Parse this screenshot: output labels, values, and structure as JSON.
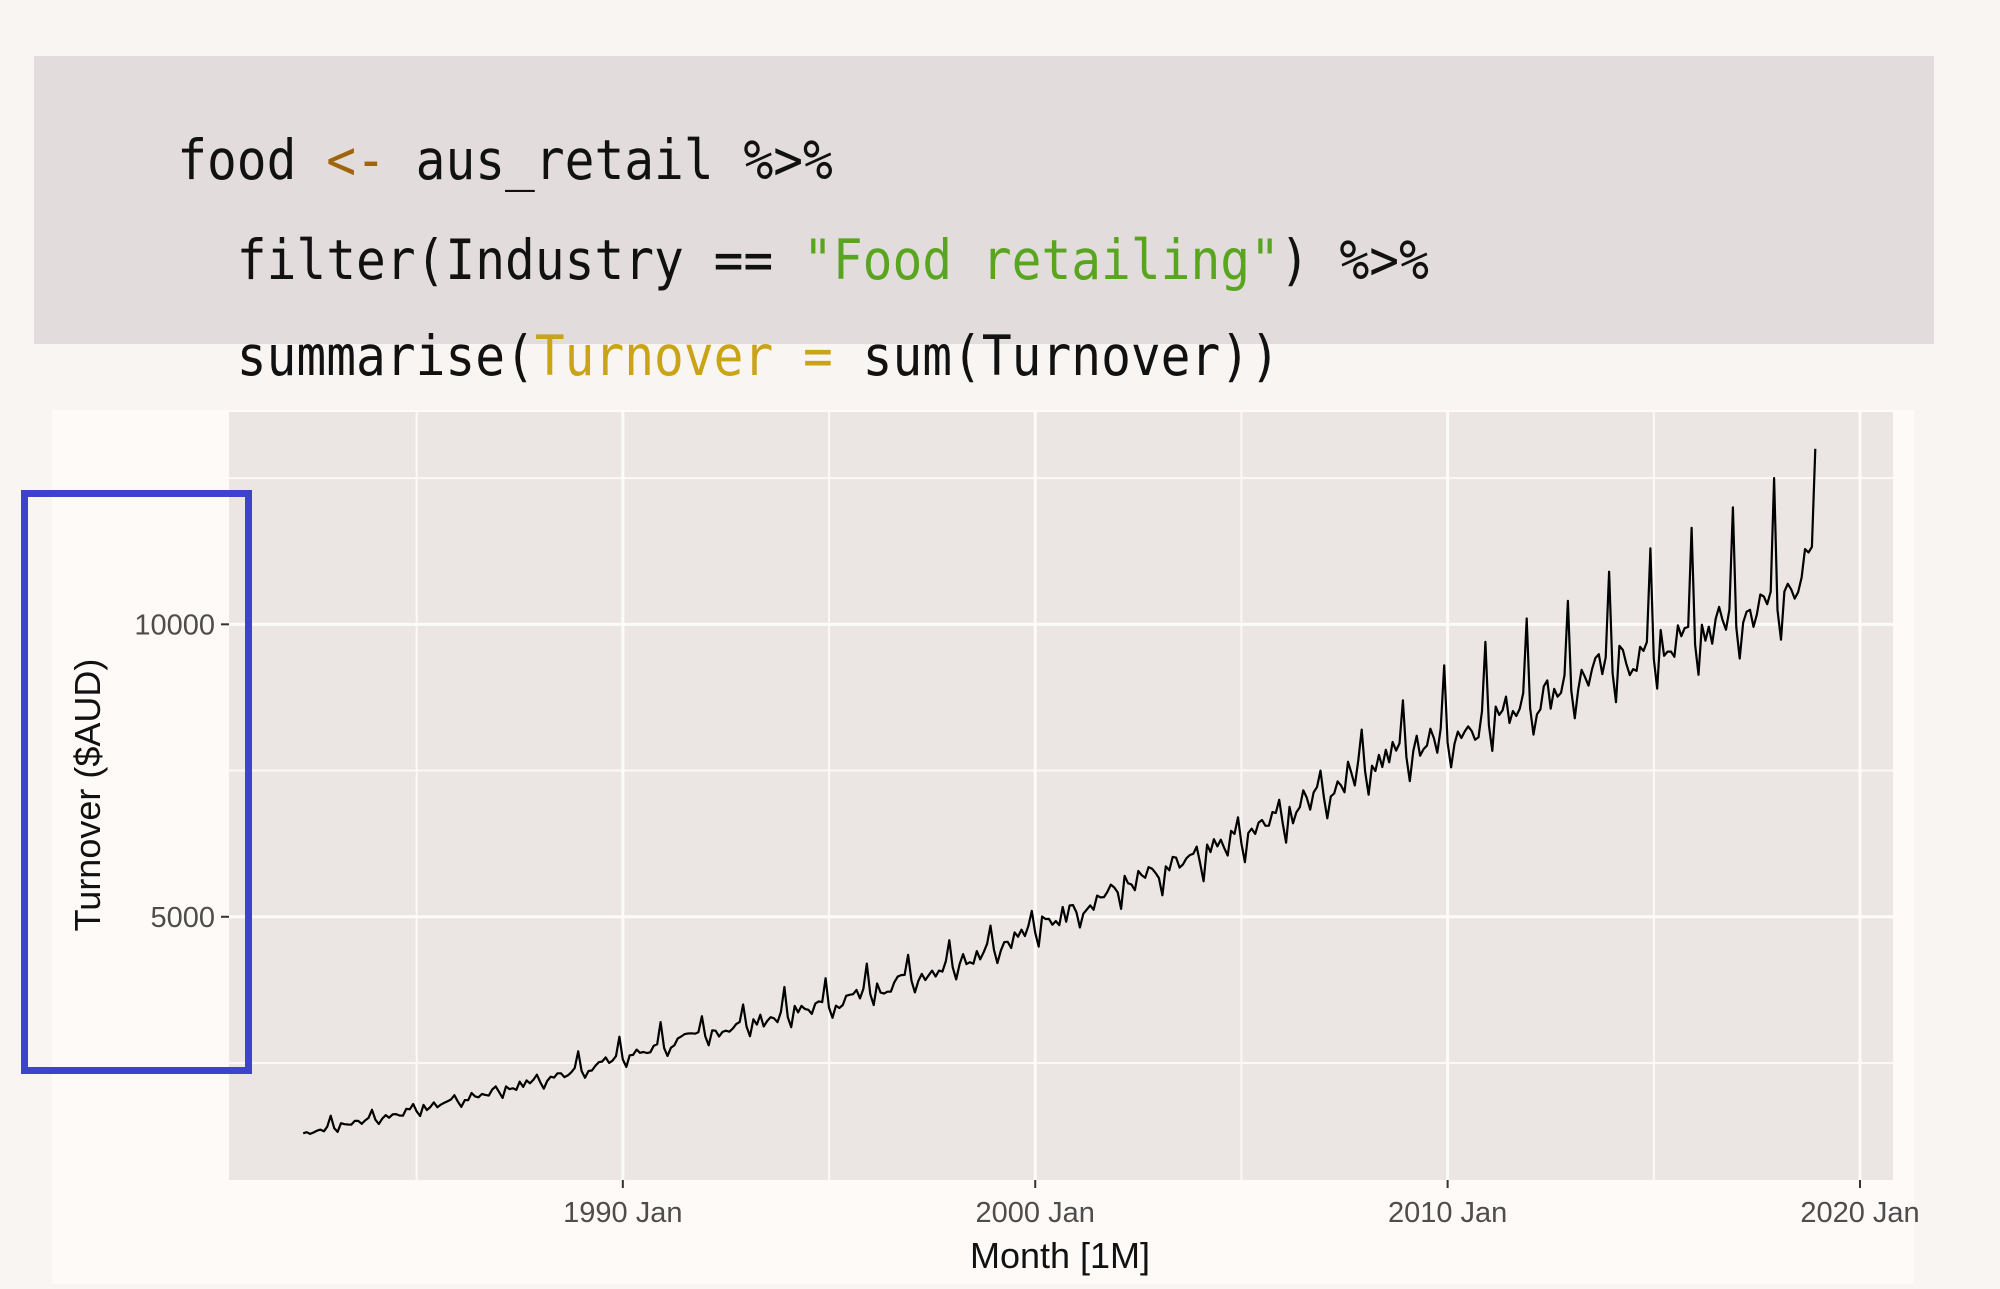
{
  "code": {
    "lines": [
      [
        {
          "text": "food ",
          "kind": "plain"
        },
        {
          "text": "<-",
          "kind": "assign"
        },
        {
          "text": " aus_retail %>%",
          "kind": "plain"
        }
      ],
      [
        {
          "text": "  filter(Industry == ",
          "kind": "plain"
        },
        {
          "text": "\"Food retailing\"",
          "kind": "string"
        },
        {
          "text": ") %>%",
          "kind": "plain"
        }
      ],
      [
        {
          "text": "  summarise(",
          "kind": "plain"
        },
        {
          "text": "Turnover =",
          "kind": "arg"
        },
        {
          "text": " sum(Turnover))",
          "kind": "plain"
        }
      ]
    ],
    "colors": {
      "assign": "#a0640c",
      "string": "#5aa51f",
      "arg": "#c9a417",
      "plain": "#111111"
    }
  },
  "highlight": {
    "target": "y-axis-title-and-ticks",
    "color": "#3e43cc"
  },
  "chart_data": {
    "type": "line",
    "title": "",
    "xlabel": "Month [1M]",
    "ylabel": "Turnover ($AUD)",
    "x_ticks": [
      {
        "label": "1990 Jan",
        "value": 1990.0
      },
      {
        "label": "2000 Jan",
        "value": 2000.0
      },
      {
        "label": "2010 Jan",
        "value": 2010.0
      },
      {
        "label": "2020 Jan",
        "value": 2020.0
      }
    ],
    "y_ticks": [
      {
        "label": "5000",
        "value": 5000
      },
      {
        "label": "10000",
        "value": 10000
      }
    ],
    "x_minor_grid": [
      1985,
      1995,
      2005,
      2015
    ],
    "y_minor_grid": [
      2500,
      7500,
      12500
    ],
    "xlim": [
      1980.45,
      2020.8
    ],
    "ylim": [
      500,
      13630
    ],
    "grid": true,
    "legend": "none",
    "series": [
      {
        "name": "Turnover",
        "color": "#000000",
        "start": "1982 Apr",
        "end": "2018 Dec",
        "frequency": "monthly",
        "annual_points": [
          {
            "year": 1982.25,
            "level": 1300
          },
          {
            "year": 1985,
            "level": 1700
          },
          {
            "year": 1988,
            "level": 2200
          },
          {
            "year": 1990,
            "level": 2600
          },
          {
            "year": 1992,
            "level": 3000
          },
          {
            "year": 1995,
            "level": 3500
          },
          {
            "year": 1998,
            "level": 4200
          },
          {
            "year": 2000,
            "level": 4800
          },
          {
            "year": 2002,
            "level": 5500
          },
          {
            "year": 2004,
            "level": 6000
          },
          {
            "year": 2006,
            "level": 6700
          },
          {
            "year": 2008,
            "level": 7600
          },
          {
            "year": 2010,
            "level": 8100
          },
          {
            "year": 2012,
            "level": 8700
          },
          {
            "year": 2014,
            "level": 9300
          },
          {
            "year": 2016,
            "level": 9800
          },
          {
            "year": 2018,
            "level": 10400
          },
          {
            "year": 2018.95,
            "level": 11200
          }
        ],
        "december_peaks": [
          {
            "year": 1982.92,
            "value": 1600
          },
          {
            "year": 1983.92,
            "value": 1700
          },
          {
            "year": 1984.92,
            "value": 1800
          },
          {
            "year": 1985.92,
            "value": 1950
          },
          {
            "year": 1986.92,
            "value": 2100
          },
          {
            "year": 1987.92,
            "value": 2300
          },
          {
            "year": 1988.92,
            "value": 2700
          },
          {
            "year": 1989.92,
            "value": 2950
          },
          {
            "year": 1990.92,
            "value": 3200
          },
          {
            "year": 1991.92,
            "value": 3300
          },
          {
            "year": 1992.92,
            "value": 3500
          },
          {
            "year": 1993.92,
            "value": 3800
          },
          {
            "year": 1994.92,
            "value": 3950
          },
          {
            "year": 1995.92,
            "value": 4200
          },
          {
            "year": 1996.92,
            "value": 4350
          },
          {
            "year": 1997.92,
            "value": 4600
          },
          {
            "year": 1998.92,
            "value": 4850
          },
          {
            "year": 1999.92,
            "value": 5100
          },
          {
            "year": 2000.92,
            "value": 5200
          },
          {
            "year": 2001.92,
            "value": 5500
          },
          {
            "year": 2002.92,
            "value": 5750
          },
          {
            "year": 2003.92,
            "value": 6200
          },
          {
            "year": 2004.92,
            "value": 6700
          },
          {
            "year": 2005.92,
            "value": 7000
          },
          {
            "year": 2006.92,
            "value": 7500
          },
          {
            "year": 2007.92,
            "value": 8200
          },
          {
            "year": 2008.92,
            "value": 8700
          },
          {
            "year": 2009.92,
            "value": 9300
          },
          {
            "year": 2010.92,
            "value": 9700
          },
          {
            "year": 2011.92,
            "value": 10100
          },
          {
            "year": 2012.92,
            "value": 10400
          },
          {
            "year": 2013.92,
            "value": 10900
          },
          {
            "year": 2014.92,
            "value": 11300
          },
          {
            "year": 2015.92,
            "value": 11650
          },
          {
            "year": 2016.92,
            "value": 12000
          },
          {
            "year": 2017.92,
            "value": 12500
          },
          {
            "year": 2018.92,
            "value": 13000
          }
        ]
      }
    ]
  }
}
